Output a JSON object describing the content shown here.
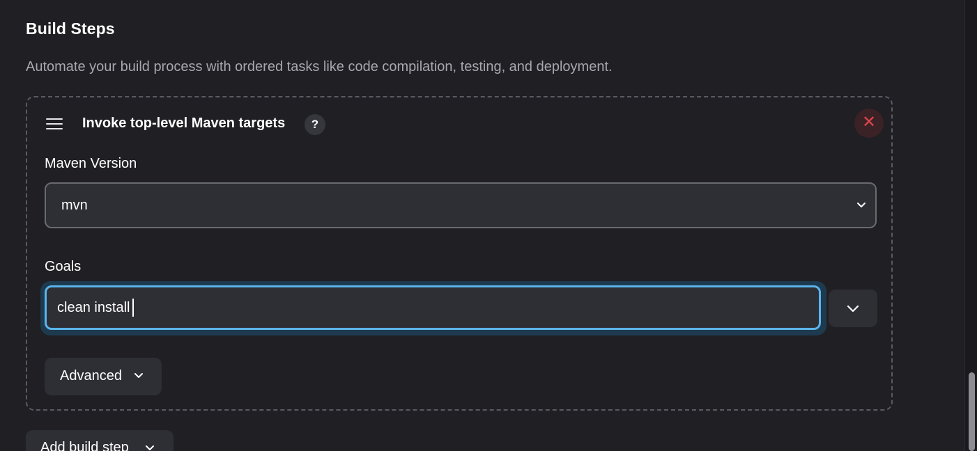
{
  "section": {
    "title": "Build Steps",
    "description": "Automate your build process with ordered tasks like code compilation, testing, and deployment."
  },
  "step": {
    "title": "Invoke top-level Maven targets",
    "help_label": "?",
    "close_symbol": "✕",
    "maven_version": {
      "label": "Maven Version",
      "selected": "mvn"
    },
    "goals": {
      "label": "Goals",
      "value": "clean install"
    },
    "advanced_label": "Advanced"
  },
  "add_build_step_label": "Add build step",
  "icons": {
    "drag": "drag-handle-icon",
    "help": "help-icon",
    "close": "close-icon",
    "chevron": "chevron-down-icon"
  },
  "colors": {
    "background": "#1f1f24",
    "focus_ring": "#5ab4ea",
    "danger": "#e0444d"
  }
}
